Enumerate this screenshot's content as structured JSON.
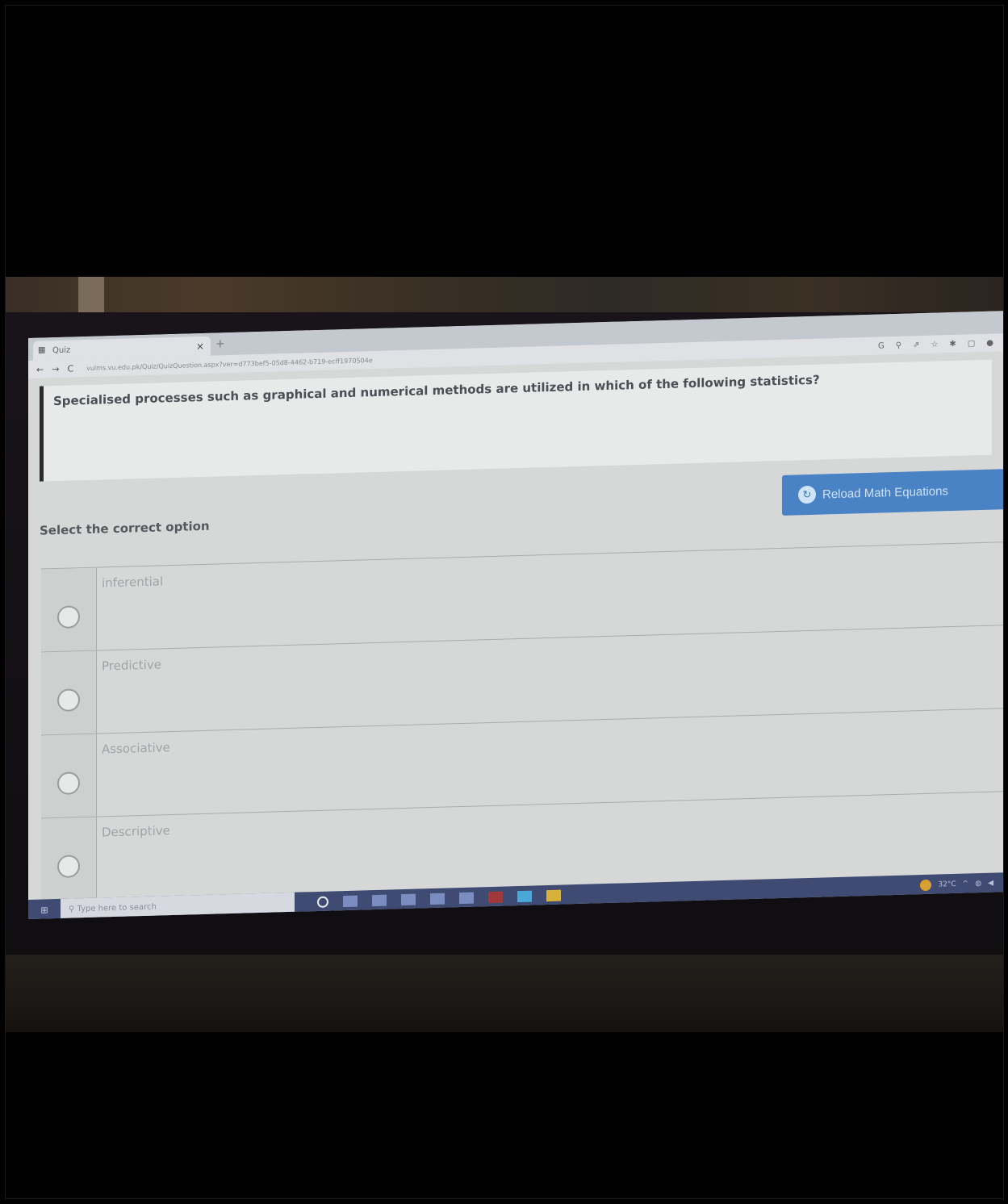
{
  "browser": {
    "tab_title": "Quiz",
    "tab_close": "×",
    "new_tab": "+",
    "url": "vulms.vu.edu.pk/Quiz/QuizQuestion.aspx?ver=d773bef5-05d8-4462-b719-ecff1970504e",
    "nav_back": "←",
    "nav_forward": "→",
    "nav_reload": "C"
  },
  "quiz": {
    "question": "Specialised processes such as graphical and numerical methods are utilized in which of the following statistics?",
    "select_label": "Select the correct option",
    "reload_button": "Reload Math Equations",
    "options": [
      {
        "label": "inferential"
      },
      {
        "label": "Predictive"
      },
      {
        "label": "Associative"
      },
      {
        "label": "Descriptive"
      }
    ]
  },
  "taskbar": {
    "search_placeholder": "Type here to search",
    "temperature": "32°C"
  },
  "annotation": {
    "checkmark_color": "#3ee89a",
    "marked_option": "Descriptive"
  }
}
